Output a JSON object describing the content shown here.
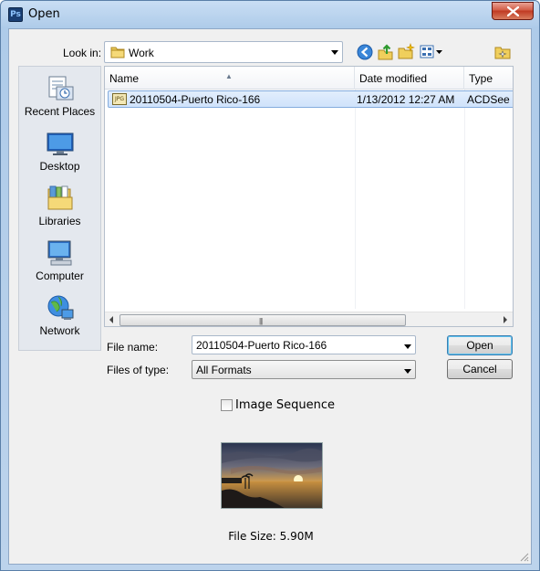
{
  "window": {
    "title": "Open",
    "app_icon_text": "Ps"
  },
  "lookin": {
    "label": "Look in:",
    "value": "Work"
  },
  "places": [
    {
      "label": "Recent Places",
      "icon": "recent-places-icon"
    },
    {
      "label": "Desktop",
      "icon": "desktop-icon"
    },
    {
      "label": "Libraries",
      "icon": "libraries-icon"
    },
    {
      "label": "Computer",
      "icon": "computer-icon"
    },
    {
      "label": "Network",
      "icon": "network-icon"
    }
  ],
  "filelist": {
    "columns": [
      "Name",
      "Date modified",
      "Type"
    ],
    "rows": [
      {
        "name": "20110504-Puerto Rico-166",
        "date": "1/13/2012 12:27 AM",
        "type": "ACDSee P",
        "icon_text": "JPG"
      }
    ]
  },
  "form": {
    "filename_label": "File name:",
    "filename_value": "20110504-Puerto Rico-166",
    "filetype_label": "Files of type:",
    "filetype_value": "All Formats",
    "open_label": "Open",
    "cancel_label": "Cancel",
    "sequence_label": "Image Sequence",
    "sequence_checked": false,
    "filesize_text": "File Size: 5.90M"
  },
  "colors": {
    "title_bar": "#c9def4",
    "selection": "#cfe2fb",
    "close_button": "#c03a23"
  }
}
